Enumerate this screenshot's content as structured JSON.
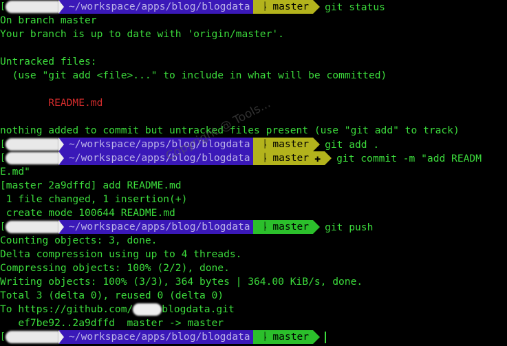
{
  "prompt": {
    "bracket": "[",
    "path": "~/workspace/apps/blog/blogdata",
    "branch": "master",
    "plus": "✚"
  },
  "session": {
    "cmd_status": "git status",
    "status_out": [
      "On branch master",
      "Your branch is up to date with 'origin/master'.",
      "",
      "Untracked files:",
      "  (use \"git add <file>...\" to include in what will be committed)",
      ""
    ],
    "untracked_file": "        README.md",
    "status_out2": [
      "",
      "nothing added to commit but untracked files present (use \"git add\" to track)"
    ],
    "cmd_add": "git add .",
    "cmd_commit": "git commit -m \"add READM",
    "commit_wrap": "E.md\"",
    "commit_out": [
      "[master 2a9dffd] add README.md",
      " 1 file changed, 1 insertion(+)",
      " create mode 100644 README.md"
    ],
    "cmd_push": "git push",
    "push_out": [
      "Counting objects: 3, done.",
      "Delta compression using up to 4 threads.",
      "Compressing objects: 100% (2/2), done.",
      "Writing objects: 100% (3/3), 364 bytes | 364.00 KiB/s, done.",
      "Total 3 (delta 0), reused 0 (delta 0)"
    ],
    "to_prefix": "To https://github.com/",
    "to_suffix": "blogdata.git",
    "push_ref": "   ef7be92..2a9dffd  master -> master"
  },
  "watermark": "Copyright @ Tools...",
  "colors": {
    "background": "#000000",
    "text": "#3cdc3c",
    "path_segment": "#3a18b8",
    "branch_dirty": "#b3b31c",
    "branch_clean": "#2bbf2b",
    "untracked": "#d42c2c"
  }
}
